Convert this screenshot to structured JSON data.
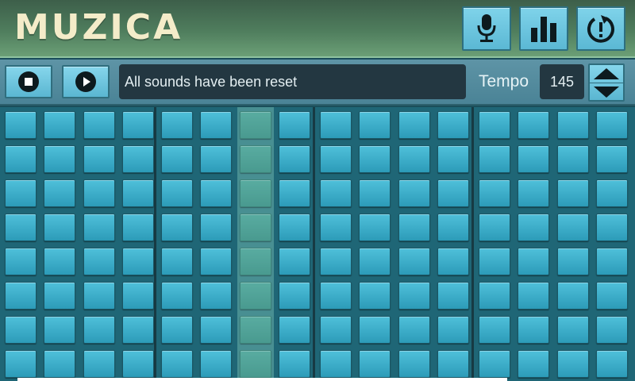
{
  "header": {
    "title": "MUZICA",
    "buttons": [
      {
        "name": "microphone",
        "icon": "microphone-icon"
      },
      {
        "name": "equalizer",
        "icon": "bar-chart-icon"
      },
      {
        "name": "reset",
        "icon": "reset-icon"
      }
    ]
  },
  "toolbar": {
    "stop_icon": "stop-icon",
    "play_icon": "play-icon",
    "status": "All sounds have been reset",
    "tempo_label": "Tempo",
    "tempo_value": "145"
  },
  "grid": {
    "columns": 16,
    "rows": 8,
    "sections": 4,
    "highlighted_column": 6
  },
  "colors": {
    "header_green": "#4f7d5d",
    "title_cream": "#f4ecc9",
    "pad_cyan": "#3fb0cc",
    "status_bg": "#233741"
  }
}
